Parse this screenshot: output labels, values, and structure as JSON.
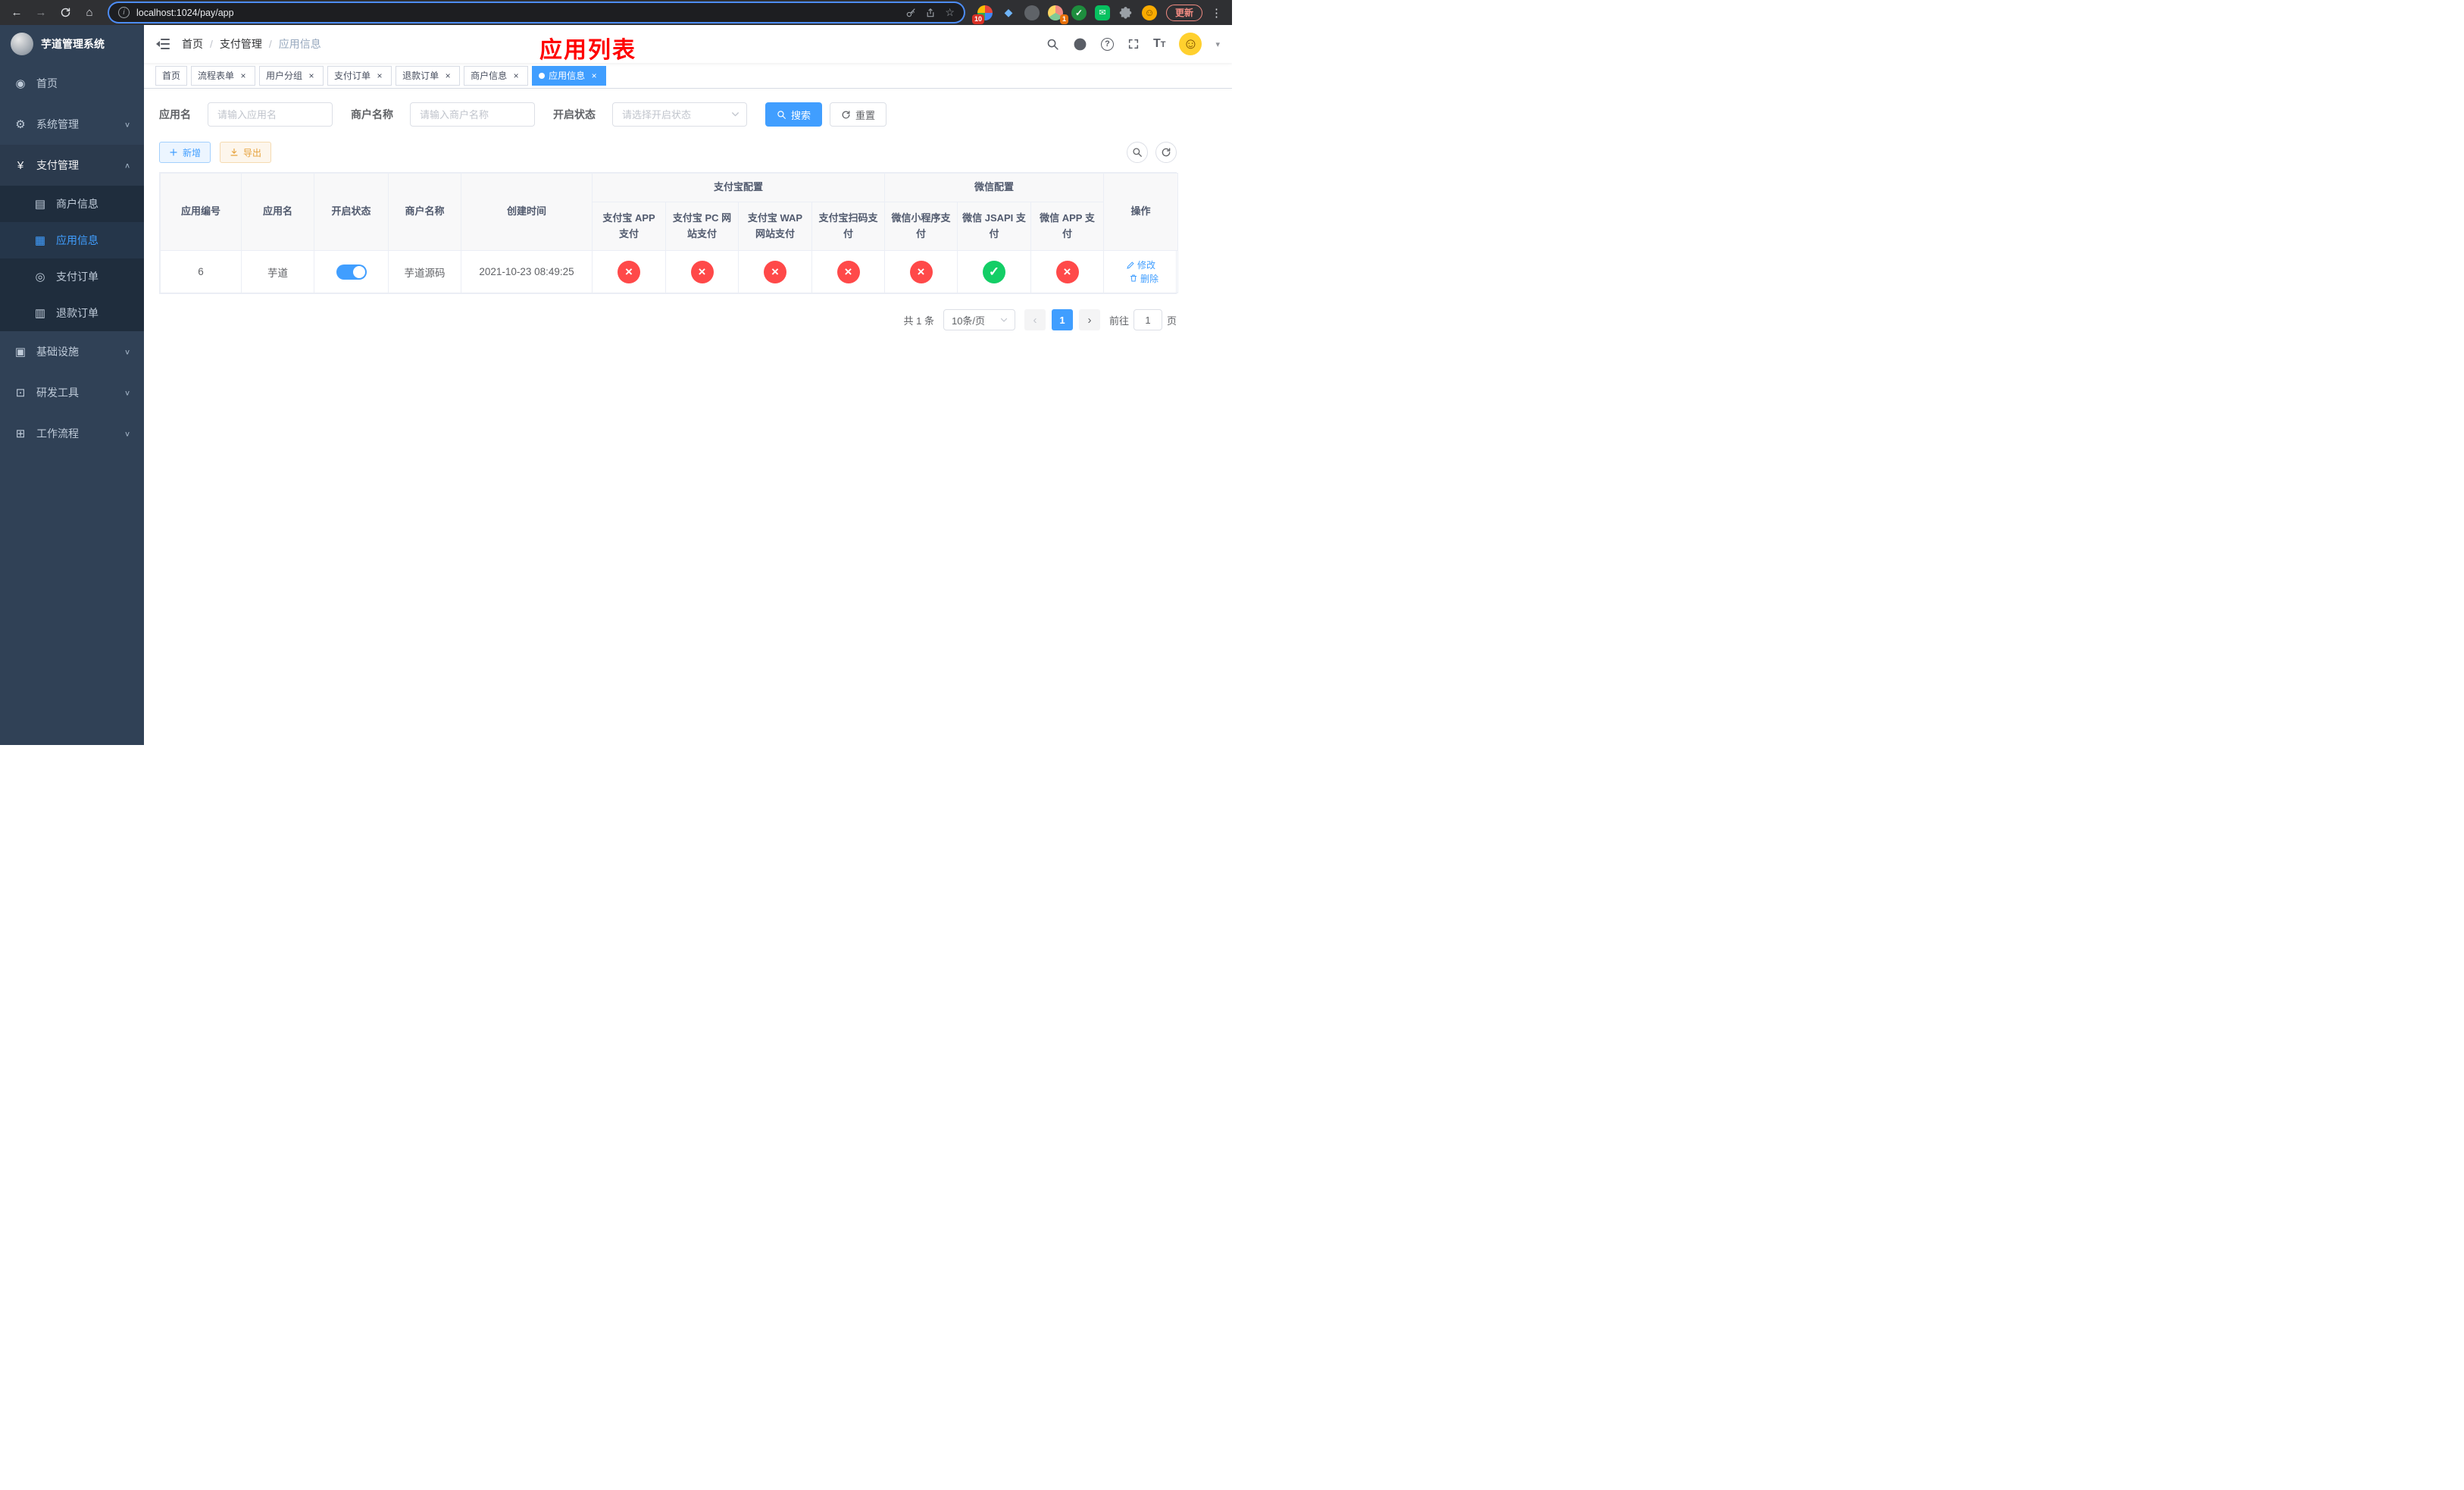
{
  "browser": {
    "url": "localhost:1024/pay/app",
    "update_label": "更新",
    "ext_badge_1": "10",
    "ext_badge_2": "1"
  },
  "icons": {
    "close": "×",
    "check": "✓",
    "cross": "×",
    "back": "←",
    "forward": "→",
    "home": "⌂",
    "kebab": "⋮",
    "star": "☆",
    "caret_down": "▾",
    "info": "i",
    "diamond": "◆",
    "envelope": "✉",
    "face": "☺",
    "avatar_face": "☺",
    "question": "?",
    "font_large": "T",
    "font_small": "T"
  },
  "sidebar": {
    "app_title": "芋道管理系统",
    "items": [
      {
        "label": "首页",
        "glyph": "◉"
      },
      {
        "label": "系统管理",
        "glyph": "⚙",
        "chevron": "∨"
      },
      {
        "label": "支付管理",
        "glyph": "¥",
        "chevron": "∧"
      },
      {
        "label": "基础设施",
        "glyph": "▣",
        "chevron": "∨"
      },
      {
        "label": "研发工具",
        "glyph": "⊡",
        "chevron": "∨"
      },
      {
        "label": "工作流程",
        "glyph": "⊞",
        "chevron": "∨"
      }
    ],
    "payment_children": [
      {
        "label": "商户信息",
        "glyph": "▤"
      },
      {
        "label": "应用信息",
        "glyph": "▦"
      },
      {
        "label": "支付订单",
        "glyph": "◎"
      },
      {
        "label": "退款订单",
        "glyph": "▥"
      }
    ]
  },
  "header": {
    "breadcrumb": [
      {
        "label": "首页"
      },
      {
        "label": "支付管理"
      },
      {
        "label": "应用信息"
      }
    ],
    "separator": "/",
    "page_title": "应用列表"
  },
  "tabs": [
    {
      "label": "首页"
    },
    {
      "label": "流程表单"
    },
    {
      "label": "用户分组"
    },
    {
      "label": "支付订单"
    },
    {
      "label": "退款订单"
    },
    {
      "label": "商户信息"
    },
    {
      "label": "应用信息"
    }
  ],
  "filters": {
    "app_name_label": "应用名",
    "app_name_placeholder": "请输入应用名",
    "merchant_label": "商户名称",
    "merchant_placeholder": "请输入商户名称",
    "status_label": "开启状态",
    "status_placeholder": "请选择开启状态",
    "search_label": "搜索",
    "reset_label": "重置"
  },
  "toolbar": {
    "add_label": "新增",
    "export_label": "导出"
  },
  "table": {
    "headers": {
      "app_id": "应用编号",
      "app_name": "应用名",
      "status": "开启状态",
      "merchant_name": "商户名称",
      "create_time": "创建时间",
      "alipay_group": "支付宝配置",
      "wechat_group": "微信配置",
      "alipay_app": "支付宝 APP 支付",
      "alipay_pc": "支付宝 PC 网站支付",
      "alipay_wap": "支付宝 WAP 网站支付",
      "alipay_qr": "支付宝扫码支付",
      "wechat_lite": "微信小程序支付",
      "wechat_jsapi": "微信 JSAPI 支付",
      "wechat_app": "微信 APP 支付",
      "actions": "操作"
    },
    "rows": [
      {
        "app_id": "6",
        "app_name": "芋道",
        "status_on": true,
        "merchant_name": "芋道源码",
        "create_time": "2021-10-23 08:49:25",
        "alipay_app": false,
        "alipay_pc": false,
        "alipay_wap": false,
        "alipay_qr": false,
        "wechat_lite": false,
        "wechat_jsapi": true,
        "wechat_app": false,
        "edit_label": "修改",
        "delete_label": "删除"
      }
    ]
  },
  "pagination": {
    "total_text": "共 1 条",
    "page_size_text": "10条/页",
    "prev": "‹",
    "page": "1",
    "next": "›",
    "goto_prefix": "前往",
    "goto_value": "1",
    "goto_suffix": "页"
  }
}
